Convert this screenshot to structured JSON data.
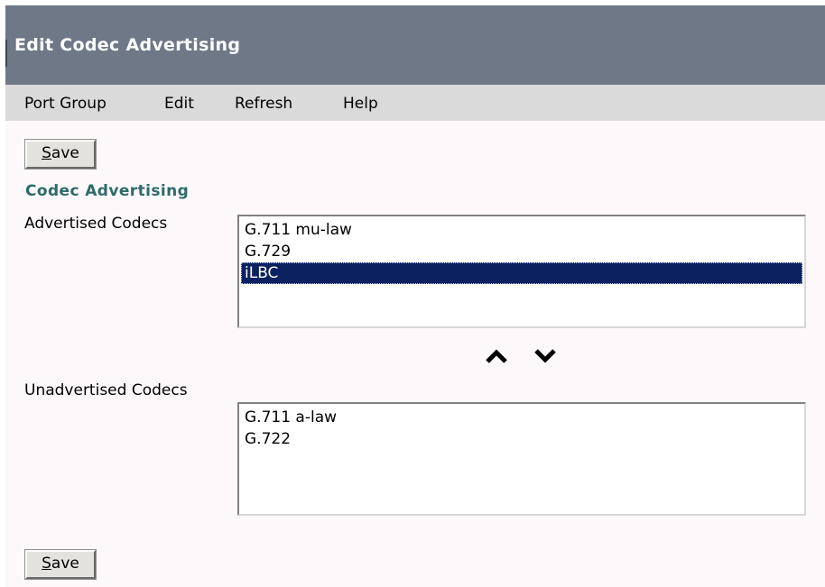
{
  "window": {
    "title": "Edit Codec Advertising"
  },
  "menu": {
    "items": [
      "Port Group",
      "Edit",
      "Refresh",
      "Help"
    ]
  },
  "buttons": {
    "save_mnemonic": "S",
    "save_rest": "ave"
  },
  "section": {
    "heading": "Codec Advertising"
  },
  "advertised": {
    "label": "Advertised Codecs",
    "options": [
      "G.711 mu-law",
      "G.729",
      "iLBC"
    ],
    "selected": "iLBC"
  },
  "unadvertised": {
    "label": "Unadvertised Codecs",
    "options": [
      "G.711 a-law",
      "G.722"
    ]
  },
  "icons": {
    "move_up": "chevron-up-icon",
    "move_down": "chevron-down-icon"
  },
  "colors": {
    "titlebar": "#6e7887",
    "heading": "#2e6b6a",
    "selection": "#0c2160",
    "menubar": "#dadada"
  }
}
